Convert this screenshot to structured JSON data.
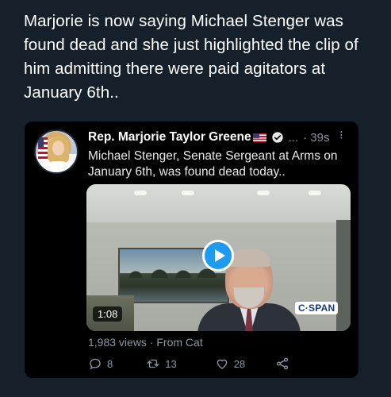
{
  "caption": "Marjorie is now saying Michael Stenger was found dead and she just highlighted the clip of him admitting there were paid agitators at January 6th..",
  "tweet": {
    "author_name": "Rep. Marjorie Taylor Greene",
    "ellipsis": "...",
    "time": "· 39s",
    "more": "⁝",
    "text": "Michael Stenger, Senate Sergeant at Arms on January 6th, was found dead today..",
    "video": {
      "duration": "1:08",
      "watermark": "C·SPAN"
    },
    "views_line": "1,983 views · From Cat",
    "actions": {
      "replies": "8",
      "retweets": "13",
      "likes": "28"
    }
  },
  "colors": {
    "background": "#15202b",
    "card": "#000000",
    "accent": "#1d9bf0",
    "muted": "#8b98a5"
  },
  "icons": [
    "us-flag-icon",
    "verified-icon",
    "more-icon",
    "play-icon",
    "reply-icon",
    "retweet-icon",
    "like-icon",
    "share-icon"
  ]
}
